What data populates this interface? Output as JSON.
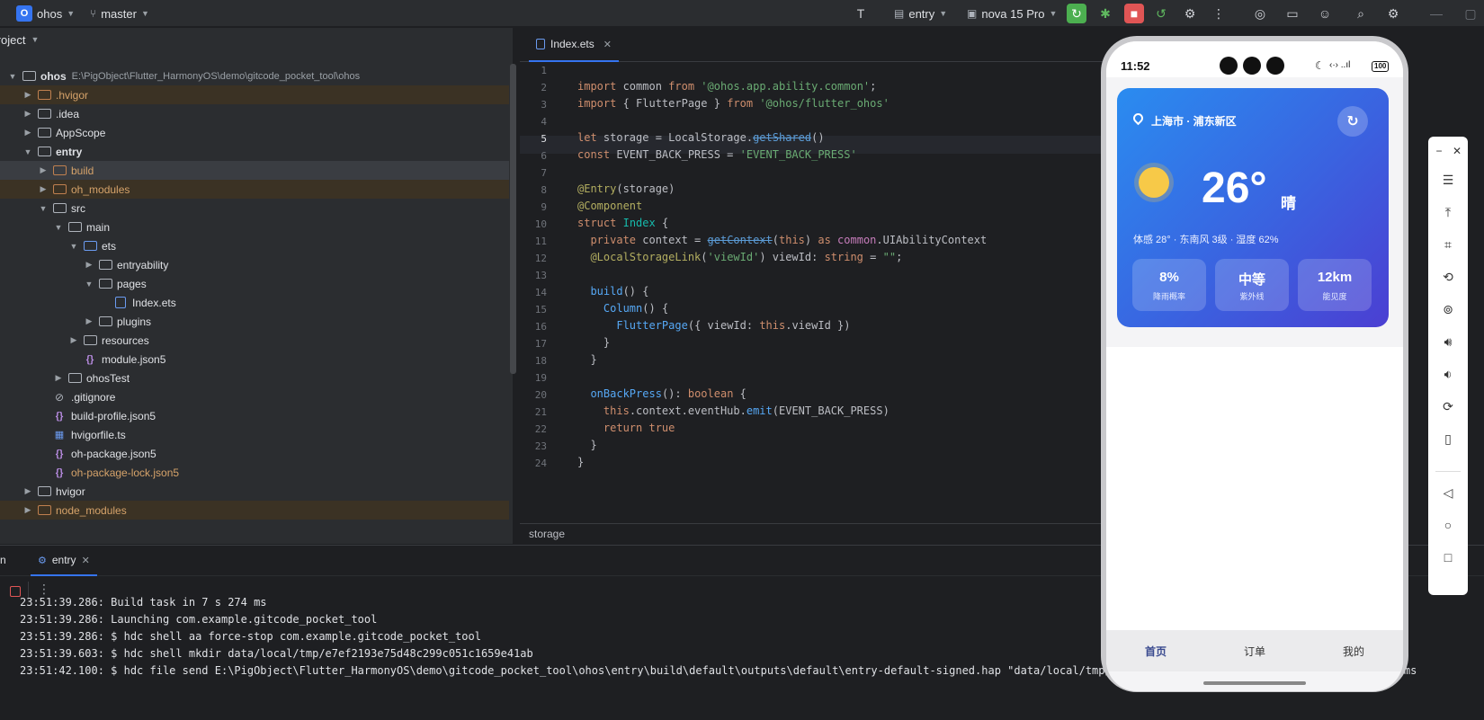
{
  "titlebar": {
    "project_badge": "O",
    "project_name": "ohos",
    "branch": "master",
    "run_config": "entry",
    "device": "nova 15 Pro"
  },
  "project_panel": {
    "title": "Project",
    "root_name": "ohos",
    "root_path": "E:\\PigObject\\Flutter_HarmonyOS\\demo\\gitcode_pocket_tool\\ohos",
    "items": [
      {
        "label": ".hvigor",
        "indent": 1,
        "arrow": "right",
        "icon": "folder-orange",
        "style": "ignored"
      },
      {
        "label": ".idea",
        "indent": 1,
        "arrow": "right",
        "icon": "folder",
        "style": ""
      },
      {
        "label": "AppScope",
        "indent": 1,
        "arrow": "right",
        "icon": "folder",
        "style": ""
      },
      {
        "label": "entry",
        "indent": 1,
        "arrow": "down",
        "icon": "folder",
        "style": "bold"
      },
      {
        "label": "build",
        "indent": 2,
        "arrow": "right",
        "icon": "folder-orange",
        "style": "selected"
      },
      {
        "label": "oh_modules",
        "indent": 2,
        "arrow": "right",
        "icon": "folder-orange",
        "style": "ignored"
      },
      {
        "label": "src",
        "indent": 2,
        "arrow": "down",
        "icon": "folder",
        "style": ""
      },
      {
        "label": "main",
        "indent": 3,
        "arrow": "down",
        "icon": "folder",
        "style": ""
      },
      {
        "label": "ets",
        "indent": 4,
        "arrow": "down",
        "icon": "folder-blue",
        "style": ""
      },
      {
        "label": "entryability",
        "indent": 5,
        "arrow": "right",
        "icon": "folder",
        "style": ""
      },
      {
        "label": "pages",
        "indent": 5,
        "arrow": "down",
        "icon": "folder",
        "style": ""
      },
      {
        "label": "Index.ets",
        "indent": 6,
        "arrow": "none",
        "icon": "file-ets",
        "style": ""
      },
      {
        "label": "plugins",
        "indent": 5,
        "arrow": "right",
        "icon": "folder",
        "style": ""
      },
      {
        "label": "resources",
        "indent": 4,
        "arrow": "right",
        "icon": "folder",
        "style": ""
      },
      {
        "label": "module.json5",
        "indent": 4,
        "arrow": "none",
        "icon": "json",
        "style": ""
      },
      {
        "label": "ohosTest",
        "indent": 3,
        "arrow": "right",
        "icon": "folder",
        "style": ""
      },
      {
        "label": ".gitignore",
        "indent": 2,
        "arrow": "none",
        "icon": "ignore",
        "style": ""
      },
      {
        "label": "build-profile.json5",
        "indent": 2,
        "arrow": "none",
        "icon": "json",
        "style": ""
      },
      {
        "label": "hvigorfile.ts",
        "indent": 2,
        "arrow": "none",
        "icon": "ts",
        "style": ""
      },
      {
        "label": "oh-package.json5",
        "indent": 2,
        "arrow": "none",
        "icon": "json",
        "style": ""
      },
      {
        "label": "oh-package-lock.json5",
        "indent": 2,
        "arrow": "none",
        "icon": "json",
        "style": "orange"
      },
      {
        "label": "hvigor",
        "indent": 1,
        "arrow": "right",
        "icon": "folder",
        "style": ""
      },
      {
        "label": "node_modules",
        "indent": 1,
        "arrow": "right",
        "icon": "folder-orange",
        "style": "ignored"
      }
    ]
  },
  "editor": {
    "tab_label": "Index.ets",
    "breadcrumb": "storage",
    "line_numbers": [
      "1",
      "2",
      "3",
      "4",
      "5",
      "6",
      "7",
      "8",
      "9",
      "10",
      "11",
      "12",
      "13",
      "14",
      "15",
      "16",
      "17",
      "18",
      "19",
      "20",
      "21",
      "22",
      "23",
      "24"
    ]
  },
  "run_panel": {
    "tab_label": "entry",
    "log_lines": [
      "23:51:39.286: Build task in 7 s 274 ms",
      "23:51:39.286: Launching com.example.gitcode_pocket_tool",
      "23:51:39.286: $ hdc shell aa force-stop com.example.gitcode_pocket_tool",
      "23:51:39.603: $ hdc shell mkdir data/local/tmp/e7ef2193e75d48c299c051c1659e41ab",
      "23:51:42.100: $ hdc file send E:\\PigObject\\Flutter_HarmonyOS\\demo\\gitcode_pocket_tool\\ohos\\entry\\build\\default\\outputs\\default\\entry-default-signed.hap \"data/local/tmp/e7ef2193e75d48c299c051c1659e41ab\" in 2 s 497 ms"
    ]
  },
  "phone": {
    "time": "11:52",
    "battery": "100",
    "location": "上海市 · 浦东新区",
    "temperature": "26°",
    "condition": "晴",
    "details": "体感 28° · 东南风 3级 · 湿度 62%",
    "stats": [
      {
        "value": "8%",
        "label": "降雨概率"
      },
      {
        "value": "中等",
        "label": "紫外线"
      },
      {
        "value": "12km",
        "label": "能见度"
      }
    ],
    "nav": [
      {
        "label": "首页",
        "active": true
      },
      {
        "label": "订单",
        "active": false
      },
      {
        "label": "我的",
        "active": false
      }
    ]
  }
}
